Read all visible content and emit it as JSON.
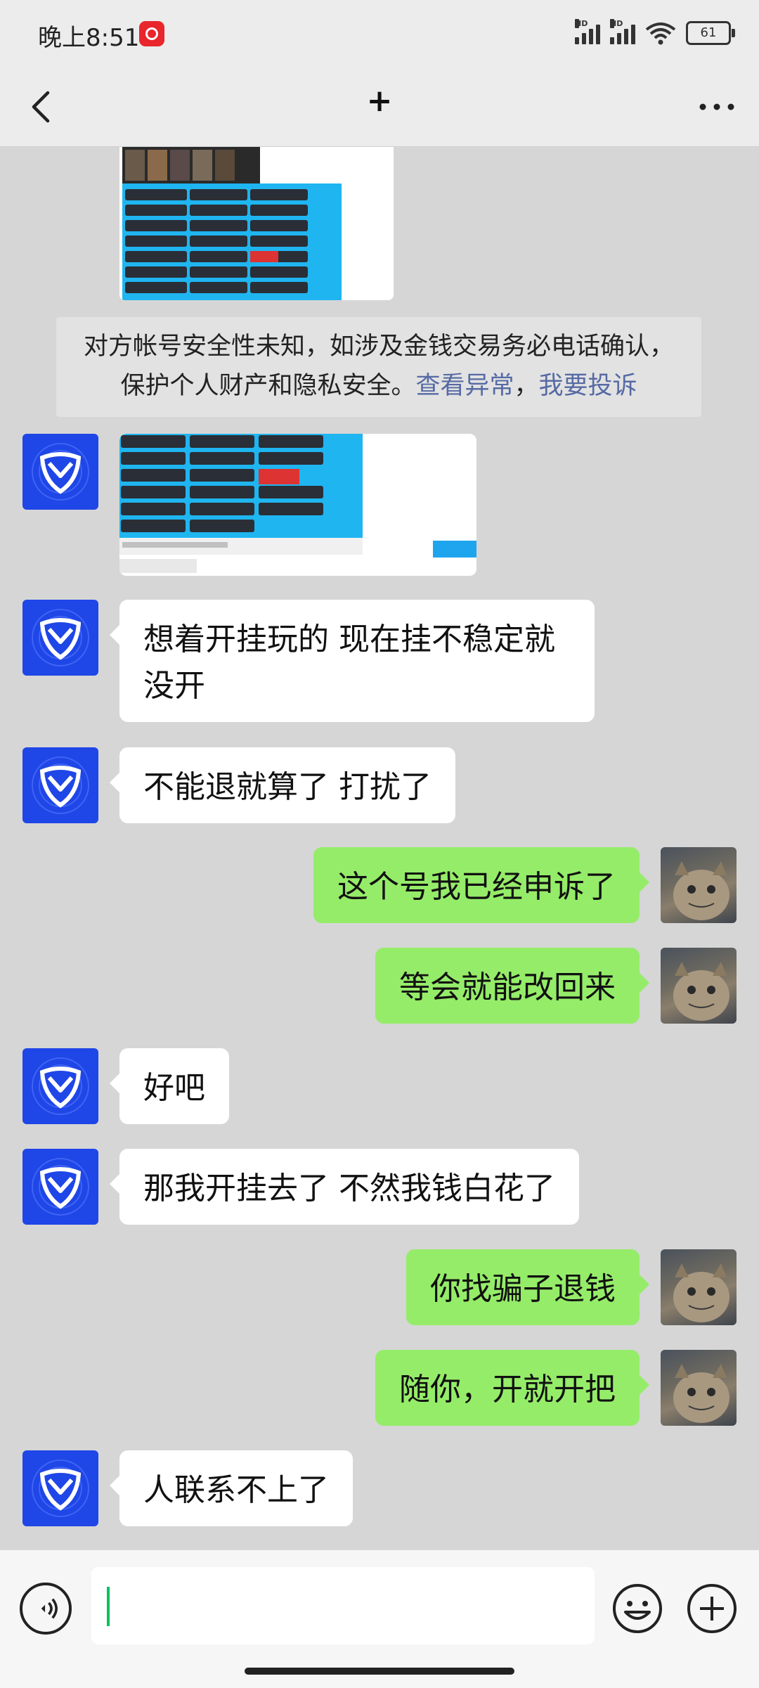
{
  "status_bar": {
    "time": "晚上8:51",
    "hd_label_1": "HD",
    "hd_label_2": "HD",
    "battery": "61"
  },
  "nav": {
    "title": "+",
    "back_icon": "chevron-left-icon",
    "more_icon": "more-dots-icon"
  },
  "warning": {
    "text_line1": "对方帐号安全性未知，如涉及金钱交易务必电话确认，",
    "text_line2": "保护个人财产和隐私安全。",
    "link_abnormal": "查看异常",
    "separator": "，",
    "link_report": "我要投诉"
  },
  "messages": [
    {
      "side": "left",
      "text": "想着开挂玩的 现在挂不稳定就没开"
    },
    {
      "side": "left",
      "text": "不能退就算了 打扰了"
    },
    {
      "side": "right",
      "text": "这个号我已经申诉了"
    },
    {
      "side": "right",
      "text": "等会就能改回来"
    },
    {
      "side": "left",
      "text": "好吧"
    },
    {
      "side": "left",
      "text": "那我开挂去了 不然我钱白花了"
    },
    {
      "side": "right",
      "text": "你找骗子退钱"
    },
    {
      "side": "right",
      "text": "随你，开就开把"
    },
    {
      "side": "left",
      "text": "人联系不上了"
    }
  ],
  "input": {
    "value": "",
    "voice_icon": "voice-icon",
    "emoji_icon": "emoji-icon",
    "plus_icon": "plus-circle-icon"
  },
  "colors": {
    "bubble_sent": "#95ec69",
    "bubble_received": "#ffffff",
    "avatar_bg": "#1f46e6",
    "link": "#566aa4"
  }
}
